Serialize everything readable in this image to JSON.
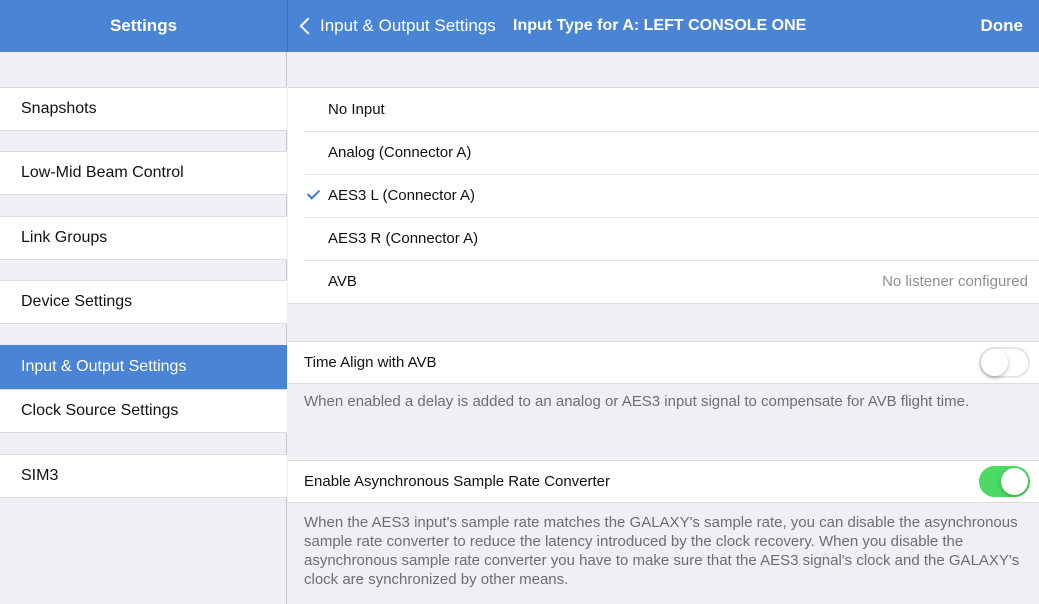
{
  "header": {
    "sidebar_title": "Settings",
    "back_label": "Input & Output Settings",
    "title": "Input Type for A: LEFT CONSOLE ONE",
    "done_label": "Done",
    "accent_color": "#4a84d4"
  },
  "sidebar": {
    "items": [
      {
        "label": "Snapshots"
      },
      {
        "label": "Low-Mid Beam Control"
      },
      {
        "label": "Link Groups"
      },
      {
        "label": "Device Settings"
      },
      {
        "label": "Input & Output Settings",
        "selected": true
      },
      {
        "label": "Clock Source Settings"
      },
      {
        "label": "SIM3"
      }
    ]
  },
  "input_options": [
    {
      "label": "No Input",
      "selected": false
    },
    {
      "label": "Analog (Connector A)",
      "selected": false
    },
    {
      "label": "AES3 L (Connector A)",
      "selected": true
    },
    {
      "label": "AES3 R (Connector A)",
      "selected": false
    },
    {
      "label": "AVB",
      "selected": false,
      "detail": "No listener configured"
    }
  ],
  "time_align": {
    "label": "Time Align with AVB",
    "enabled": false,
    "description": "When enabled a delay is added to an analog or AES3 input signal to compensate for AVB flight time."
  },
  "asrc": {
    "label": "Enable Asynchronous Sample Rate Converter",
    "enabled": true,
    "description": "When the AES3 input's sample rate matches the GALAXY's sample rate, you can disable the asynchronous sample rate converter to reduce the latency introduced by the clock recovery. When you disable the asynchronous sample rate converter you have to make sure that the AES3 signal's clock and the GALAXY's clock are synchronized by other means."
  },
  "colors": {
    "toggle_on": "#4cd964",
    "check": "#3a7bd5"
  }
}
